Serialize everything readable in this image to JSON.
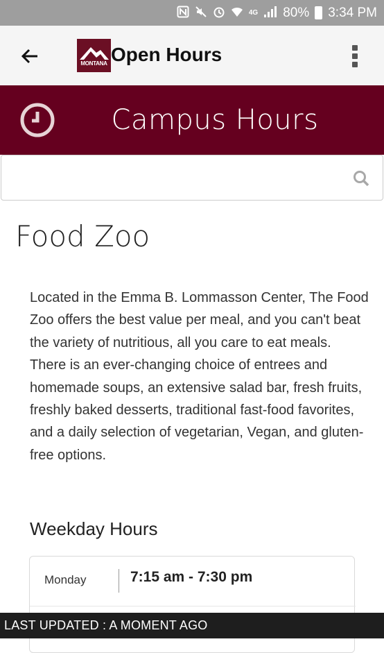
{
  "status_bar": {
    "icons": [
      "nfc-icon",
      "mute-icon",
      "alarm-icon",
      "wifi-icon",
      "lte-icon",
      "signal-icon"
    ],
    "network_label": "4G",
    "battery_percent": "80%",
    "time": "3:34 PM"
  },
  "app_bar": {
    "logo_text": "MONTANA",
    "title": "Open Hours"
  },
  "banner": {
    "title": "Campus Hours",
    "accent_color": "#65001f"
  },
  "search": {
    "value": "",
    "placeholder": ""
  },
  "location": {
    "name": "Food Zoo",
    "description": "Located in the Emma B. Lommasson Center, The Food Zoo offers the best value per meal, and you can't beat the variety of nutritious, all you care to eat meals. There is an ever-changing choice of entrees and homemade soups, an extensive salad bar, fresh fruits, freshly baked desserts, traditional fast-food favorites, and a daily selection of vegetarian, Vegan, and gluten-free options."
  },
  "weekday_hours": {
    "title": "Weekday Hours",
    "rows": [
      {
        "day": "Monday",
        "hours": "7:15 am - 7:30 pm"
      }
    ]
  },
  "footer": {
    "text": "LAST UPDATED : A MOMENT AGO"
  }
}
